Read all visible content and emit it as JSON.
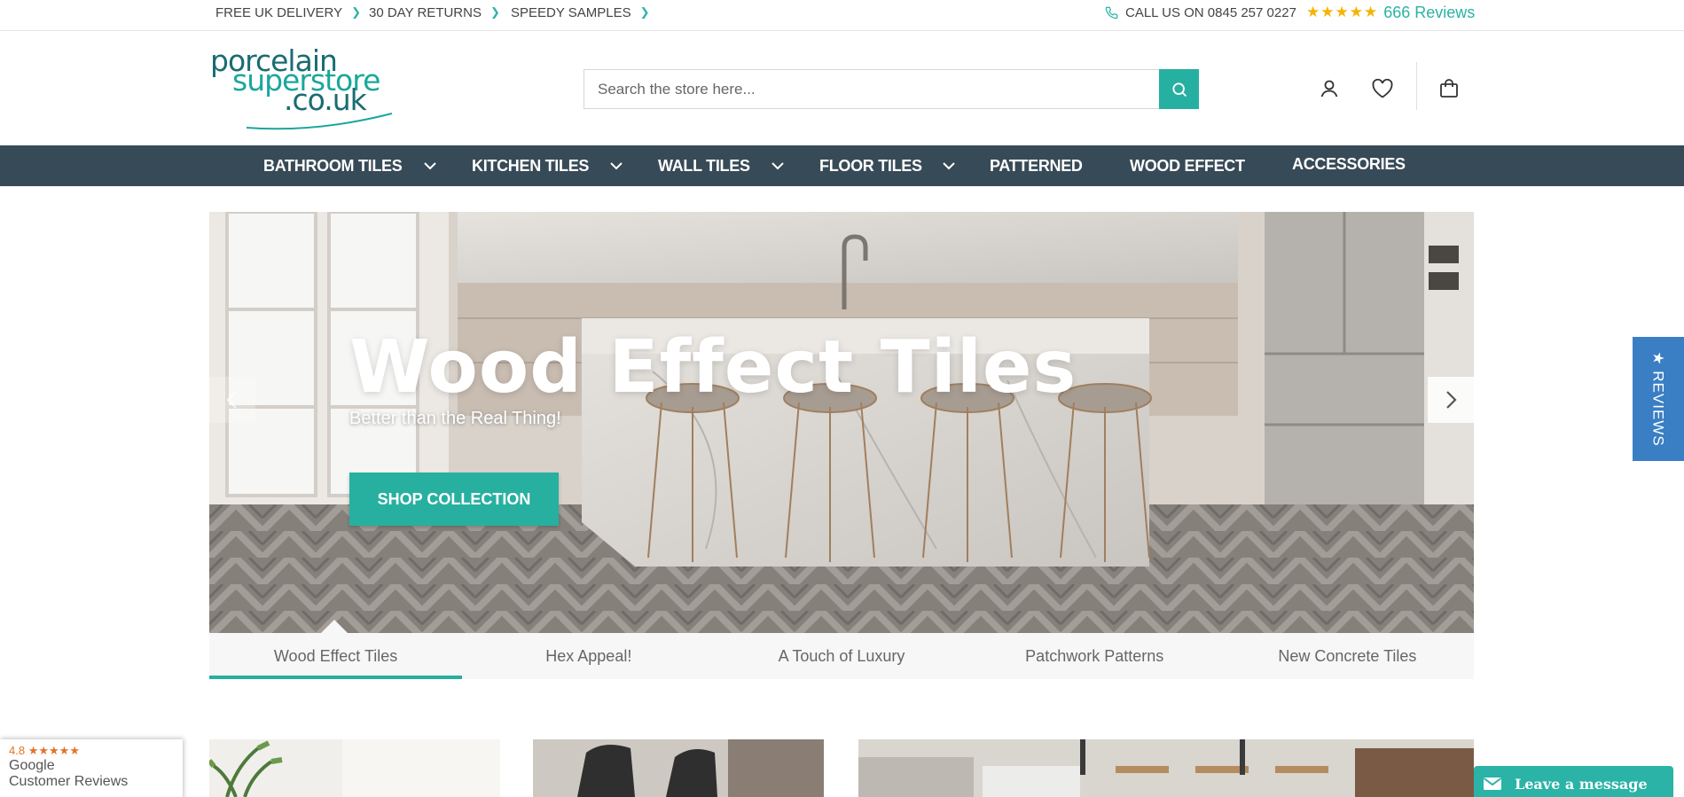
{
  "topbar": {
    "usps": [
      "FREE UK DELIVERY",
      "30 DAY RETURNS",
      "SPEEDY SAMPLES"
    ],
    "phone_text": "CALL US ON 0845 257 0227",
    "stars": "★★★★★",
    "reviews_count": "666 Reviews"
  },
  "logo": {
    "line1": "porcelain",
    "line2": "superstore",
    "line3": ".co.uk"
  },
  "search": {
    "placeholder": "Search the store here..."
  },
  "header_icons": [
    "account-icon",
    "heart-icon",
    "cart-icon"
  ],
  "nav": {
    "items": [
      "BATHROOM TILES",
      "KITCHEN TILES",
      "WALL TILES",
      "FLOOR TILES",
      "PATTERNED",
      "WOOD EFFECT",
      "ACCESSORIES"
    ]
  },
  "hero": {
    "title": "Wood Effect Tiles",
    "subtitle": "Better than the Real Thing!",
    "cta_label": "SHOP COLLECTION"
  },
  "slider_tabs": [
    "Wood Effect Tiles",
    "Hex Appeal!",
    "A Touch of Luxury",
    "Patchwork Patterns",
    "New Concrete Tiles"
  ],
  "active_tab": "Wood Effect Tiles",
  "reviews_tab": "★ REVIEWS",
  "google_badge": {
    "rating": "4.8",
    "stars": "★★★★★",
    "line1": "Google",
    "line2": "Customer Reviews"
  },
  "chat": {
    "label": "Leave a message"
  },
  "colors": {
    "accent": "#26b0a1",
    "nav_bg": "#374a57",
    "star": "#f5b301",
    "reviews_tab": "#3a7fc4"
  }
}
